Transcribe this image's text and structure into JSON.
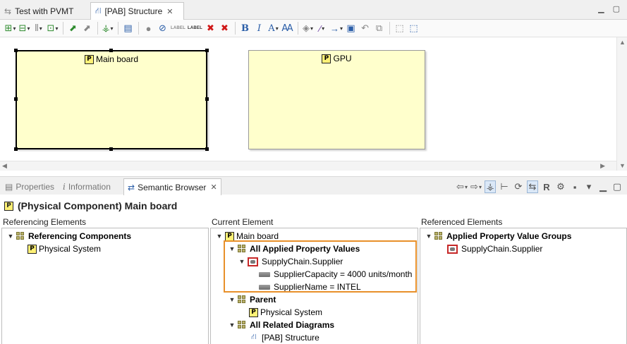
{
  "editor_tabs": [
    {
      "label": "Test with PVMT",
      "active": false
    },
    {
      "label": "[PAB] Structure",
      "active": true
    }
  ],
  "diagram": {
    "components": [
      {
        "label": "Main board",
        "selected": true
      },
      {
        "label": "GPU",
        "selected": false
      }
    ]
  },
  "toolbar": {
    "icons": [
      "arrange-all-icon",
      "arrange-selection-icon",
      "align-icon",
      "layout-icon",
      "pin-icon",
      "unpin-icon",
      "hierarchy-icon",
      "copy-format-icon",
      "show-element-icon",
      "hide-element-icon",
      "show-label-icon",
      "hide-label-icon",
      "delete-from-diagram-icon",
      "delete-from-model-icon",
      "bold-icon",
      "italic-icon",
      "font-color-icon",
      "font-icon",
      "fill-color-icon",
      "line-color-icon",
      "line-style-icon",
      "image-icon",
      "undo-icon",
      "copy-layout-icon",
      "select-all-icon",
      "zoom-icon"
    ]
  },
  "view_tabs": [
    {
      "label": "Properties",
      "active": false
    },
    {
      "label": "Information",
      "active": false
    },
    {
      "label": "Semantic Browser",
      "active": true
    }
  ],
  "semantic_browser": {
    "title": "(Physical Component) Main board",
    "columns": {
      "referencing": "Referencing Elements",
      "current": "Current Element",
      "referenced": "Referenced Elements"
    },
    "referencing_tree": [
      {
        "label": "Referencing Components",
        "bold": true,
        "icon": "group-icon",
        "expanded": true,
        "level": 0
      },
      {
        "label": "Physical System",
        "bold": false,
        "icon": "physical-component-icon",
        "level": 1
      }
    ],
    "current_tree": [
      {
        "label": "Main board",
        "bold": false,
        "icon": "physical-component-icon",
        "expanded": true,
        "level": 0
      },
      {
        "label": "All Applied Property Values",
        "bold": true,
        "icon": "group-icon",
        "expanded": true,
        "level": 1
      },
      {
        "label": "SupplyChain.Supplier",
        "bold": false,
        "icon": "property-group-icon",
        "expanded": true,
        "level": 2
      },
      {
        "label": "SupplierCapacity = 4000 units/month",
        "bold": false,
        "icon": "property-value-icon",
        "level": 3
      },
      {
        "label": "SupplierName = INTEL",
        "bold": false,
        "icon": "property-value-icon",
        "level": 3
      },
      {
        "label": "Parent",
        "bold": true,
        "icon": "group-icon",
        "expanded": true,
        "level": 1
      },
      {
        "label": "Physical System",
        "bold": false,
        "icon": "physical-component-icon",
        "level": 2
      },
      {
        "label": "All Related Diagrams",
        "bold": true,
        "icon": "group-icon",
        "expanded": true,
        "level": 1
      },
      {
        "label": "[PAB] Structure",
        "bold": false,
        "icon": "diagram-icon",
        "level": 2
      }
    ],
    "referenced_tree": [
      {
        "label": "Applied Property Value Groups",
        "bold": true,
        "icon": "group-icon",
        "expanded": true,
        "level": 0
      },
      {
        "label": "SupplyChain.Supplier",
        "bold": false,
        "icon": "property-group-icon",
        "level": 1
      }
    ]
  },
  "colors": {
    "component_fill": "#ffffcc",
    "highlight_border": "#e8902a",
    "supplier_icon": "#c62828"
  }
}
